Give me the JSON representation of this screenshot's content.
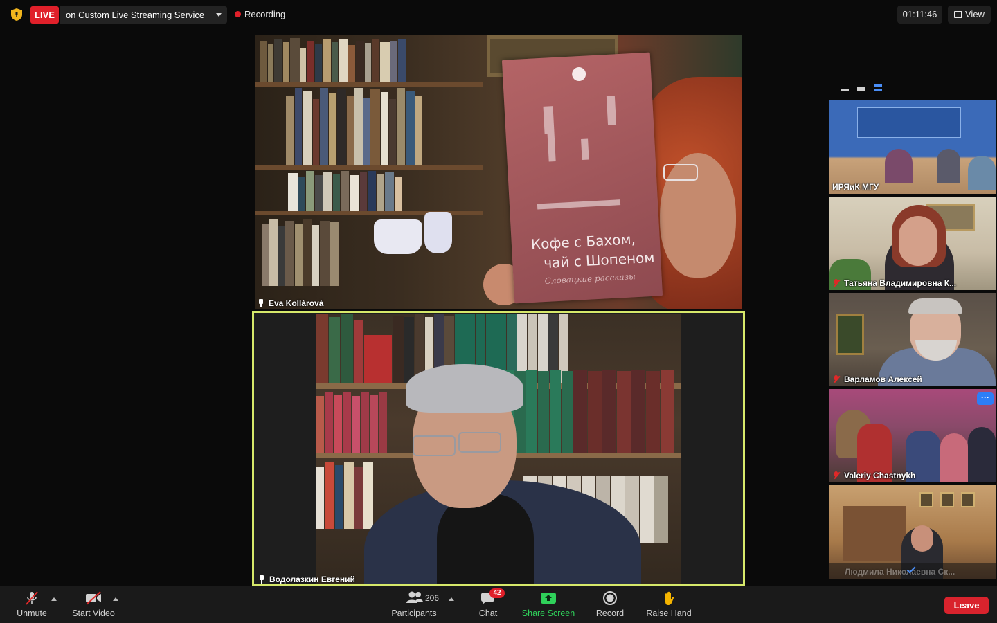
{
  "topbar": {
    "live_label": "LIVE",
    "stream_target": "on Custom Live Streaming Service",
    "recording_label": "Recording",
    "timer": "01:11:46",
    "view_label": "View"
  },
  "main_videos": [
    {
      "name": "Eva Kollárová",
      "book_title_line1": "Кофе с Бахом,",
      "book_title_line2": "чай с Шопеном",
      "book_subtitle": "Словацкие рассказы"
    },
    {
      "name": "Водолазкин Евгений",
      "active_speaker": true
    }
  ],
  "side_panel": {
    "thumbnails": [
      {
        "name": "ИРЯиК МГУ",
        "muted": false
      },
      {
        "name": "Татьяна Владимировна К...",
        "muted": true
      },
      {
        "name": "Варламов Алексей",
        "muted": true
      },
      {
        "name": "Valeriy Chastnykh",
        "muted": true,
        "more_label": "···"
      },
      {
        "name": "Людмила Николаевна Ск...",
        "muted": false
      }
    ]
  },
  "toolbar": {
    "unmute_label": "Unmute",
    "start_video_label": "Start Video",
    "participants_count": "206",
    "participants_label": "Participants",
    "chat_label": "Chat",
    "chat_badge": "42",
    "share_screen_label": "Share Screen",
    "record_label": "Record",
    "raise_hand_label": "Raise Hand",
    "leave_label": "Leave"
  },
  "colors": {
    "live_red": "#e0202a",
    "active_speaker_border": "#d6e86a",
    "share_green": "#2fd15a",
    "leave_red": "#d9232d",
    "more_blue": "#2d7ef7"
  }
}
